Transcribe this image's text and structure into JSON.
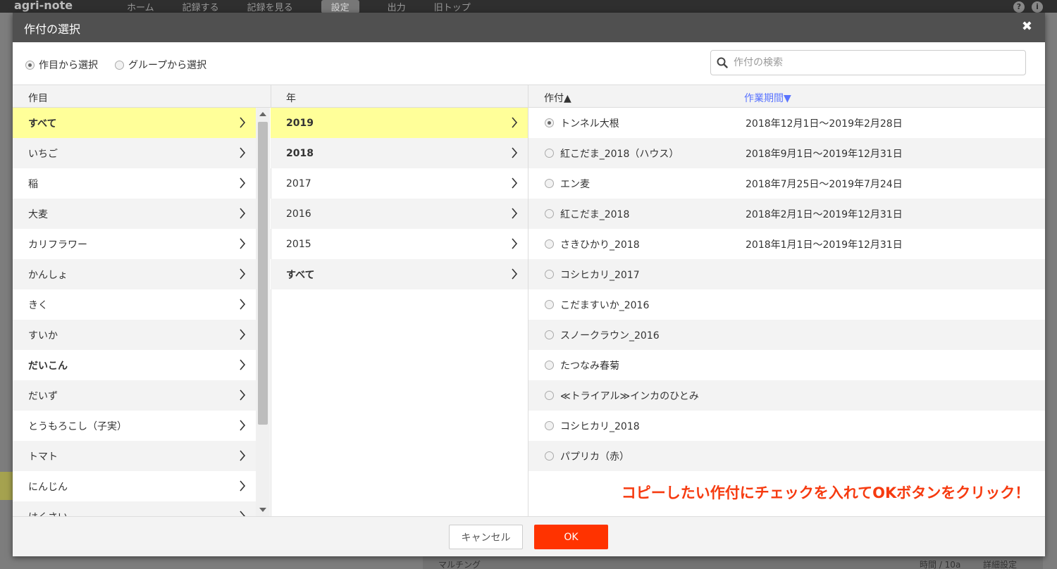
{
  "app": {
    "logo": "agri-note",
    "nav": [
      "ホーム",
      "記録する",
      "記録を見る",
      "設定",
      "出力",
      "旧トップ"
    ],
    "bottom_row_label": "マルチング",
    "bottom_row_unit": "時間 / 10a",
    "bottom_row_link": "詳細設定"
  },
  "modal": {
    "title": "作付の選択",
    "close_glyph": "✖"
  },
  "mode": {
    "by_crop": "作目から選択",
    "by_group": "グループから選択",
    "selected": "by_crop"
  },
  "search": {
    "placeholder": "作付の検索",
    "value": ""
  },
  "columns": {
    "crop": "作目",
    "year": "年",
    "plan": "作付▲",
    "period": "作業期間▼"
  },
  "crops": [
    {
      "label": "すべて",
      "bold": true,
      "selected": true
    },
    {
      "label": "いちご",
      "bold": false,
      "selected": false
    },
    {
      "label": "稲",
      "bold": false,
      "selected": false
    },
    {
      "label": "大麦",
      "bold": false,
      "selected": false
    },
    {
      "label": "カリフラワー",
      "bold": false,
      "selected": false
    },
    {
      "label": "かんしょ",
      "bold": false,
      "selected": false
    },
    {
      "label": "きく",
      "bold": false,
      "selected": false
    },
    {
      "label": "すいか",
      "bold": false,
      "selected": false
    },
    {
      "label": "だいこん",
      "bold": true,
      "selected": false
    },
    {
      "label": "だいず",
      "bold": false,
      "selected": false
    },
    {
      "label": "とうもろこし（子実）",
      "bold": false,
      "selected": false
    },
    {
      "label": "トマト",
      "bold": false,
      "selected": false
    },
    {
      "label": "にんじん",
      "bold": false,
      "selected": false
    },
    {
      "label": "はくさい",
      "bold": false,
      "selected": false
    }
  ],
  "years": [
    {
      "label": "2019",
      "bold": true,
      "selected": true
    },
    {
      "label": "2018",
      "bold": true,
      "selected": false
    },
    {
      "label": "2017",
      "bold": false,
      "selected": false
    },
    {
      "label": "2016",
      "bold": false,
      "selected": false
    },
    {
      "label": "2015",
      "bold": false,
      "selected": false
    },
    {
      "label": "すべて",
      "bold": true,
      "selected": false
    }
  ],
  "plans": [
    {
      "name": "トンネル大根",
      "period": "2018年12月1日〜2019年2月28日",
      "checked": true
    },
    {
      "name": "紅こだま_2018（ハウス）",
      "period": "2018年9月1日〜2019年12月31日",
      "checked": false
    },
    {
      "name": "エン麦",
      "period": "2018年7月25日〜2019年7月24日",
      "checked": false
    },
    {
      "name": "紅こだま_2018",
      "period": "2018年2月1日〜2019年12月31日",
      "checked": false
    },
    {
      "name": "さきひかり_2018",
      "period": "2018年1月1日〜2019年12月31日",
      "checked": false
    },
    {
      "name": "コシヒカリ_2017",
      "period": "",
      "checked": false
    },
    {
      "name": "こだますいか_2016",
      "period": "",
      "checked": false
    },
    {
      "name": "スノークラウン_2016",
      "period": "",
      "checked": false
    },
    {
      "name": "たつなみ春菊",
      "period": "",
      "checked": false
    },
    {
      "name": "≪トライアル≫インカのひとみ",
      "period": "",
      "checked": false
    },
    {
      "name": "コシヒカリ_2018",
      "period": "",
      "checked": false
    },
    {
      "name": "パプリカ（赤）",
      "period": "",
      "checked": false
    }
  ],
  "hint": "コピーしたい作付にチェックを入れてOKボタンをクリック！",
  "buttons": {
    "cancel": "キャンセル",
    "ok": "OK"
  },
  "colors": {
    "header_bg": "#505050",
    "selected_row": "#ffff99",
    "ok_button": "#ff3300",
    "hint_text": "#f63a0f",
    "sort_link": "#5a74ff"
  }
}
